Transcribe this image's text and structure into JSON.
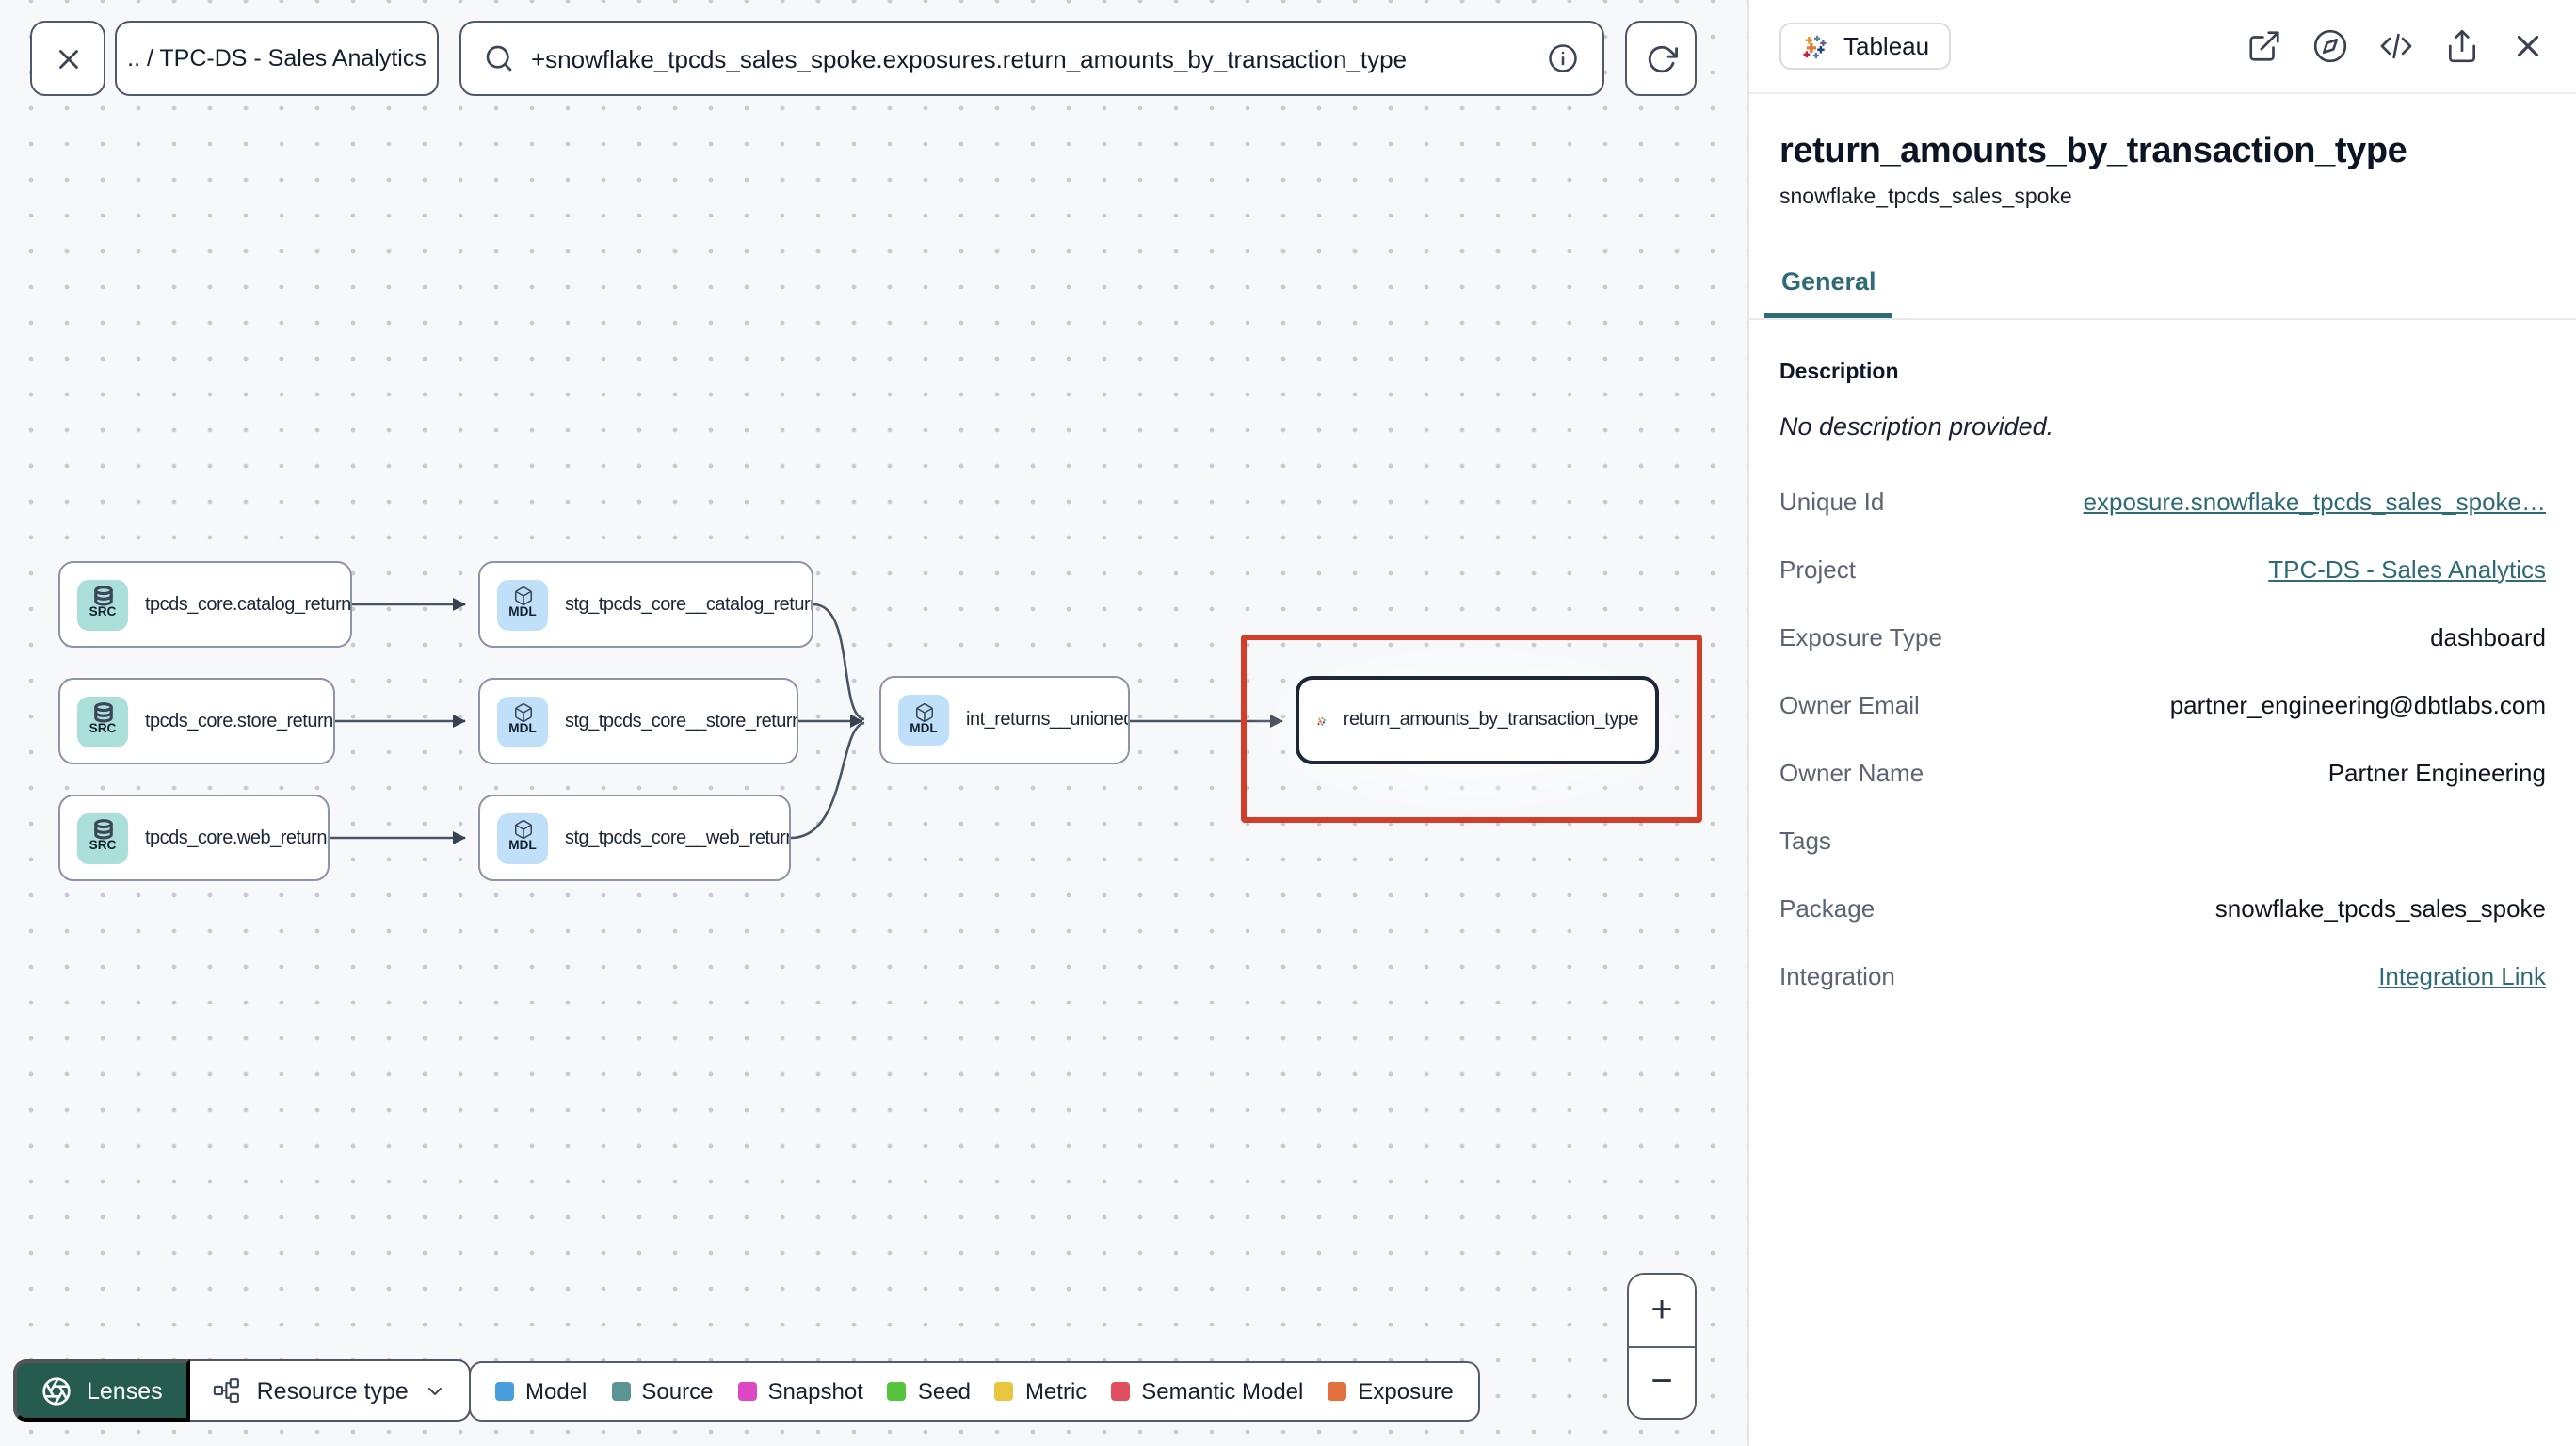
{
  "topbar": {
    "breadcrumb": ".. / TPC-DS - Sales Analytics",
    "search_value": "+snowflake_tpcds_sales_spoke.exposures.return_amounts_by_transaction_type"
  },
  "graph": {
    "nodes": [
      {
        "badge": "SRC",
        "label": "tpcds_core.catalog_returns"
      },
      {
        "badge": "SRC",
        "label": "tpcds_core.store_returns"
      },
      {
        "badge": "SRC",
        "label": "tpcds_core.web_returns"
      },
      {
        "badge": "MDL",
        "label": "stg_tpcds_core__catalog_returns"
      },
      {
        "badge": "MDL",
        "label": "stg_tpcds_core__store_returns"
      },
      {
        "badge": "MDL",
        "label": "stg_tpcds_core__web_returns"
      },
      {
        "badge": "MDL",
        "label": "int_returns__unioned"
      },
      {
        "badge": "tableau",
        "label": "return_amounts_by_transaction_type"
      }
    ],
    "highlight_color": "#d23e28"
  },
  "controls": {
    "lenses_label": "Lenses",
    "resource_type_label": "Resource type",
    "zoom_in": "+",
    "zoom_out": "−"
  },
  "legend": {
    "items": [
      {
        "label": "Model",
        "color": "#489fdb"
      },
      {
        "label": "Source",
        "color": "#5b9492"
      },
      {
        "label": "Snapshot",
        "color": "#dd47c4"
      },
      {
        "label": "Seed",
        "color": "#56c33c"
      },
      {
        "label": "Metric",
        "color": "#e8c63f"
      },
      {
        "label": "Semantic Model",
        "color": "#df4f5e"
      },
      {
        "label": "Exposure",
        "color": "#e2713f"
      }
    ]
  },
  "panel": {
    "tool_badge": "Tableau",
    "title": "return_amounts_by_transaction_type",
    "subtitle": "snowflake_tpcds_sales_spoke",
    "tab": "General",
    "description_label": "Description",
    "description_empty": "No description provided.",
    "rows": [
      {
        "label": "Unique Id",
        "value": "exposure.snowflake_tpcds_sales_spoke…"
      },
      {
        "label": "Project",
        "value": "TPC-DS - Sales Analytics"
      },
      {
        "label": "Exposure Type",
        "value": "dashboard"
      },
      {
        "label": "Owner Email",
        "value": "partner_engineering@dbtlabs.com"
      },
      {
        "label": "Owner Name",
        "value": "Partner Engineering"
      },
      {
        "label": "Tags",
        "value": ""
      },
      {
        "label": "Package",
        "value": "snowflake_tpcds_sales_spoke"
      },
      {
        "label": "Integration",
        "value": "Integration Link"
      }
    ]
  }
}
